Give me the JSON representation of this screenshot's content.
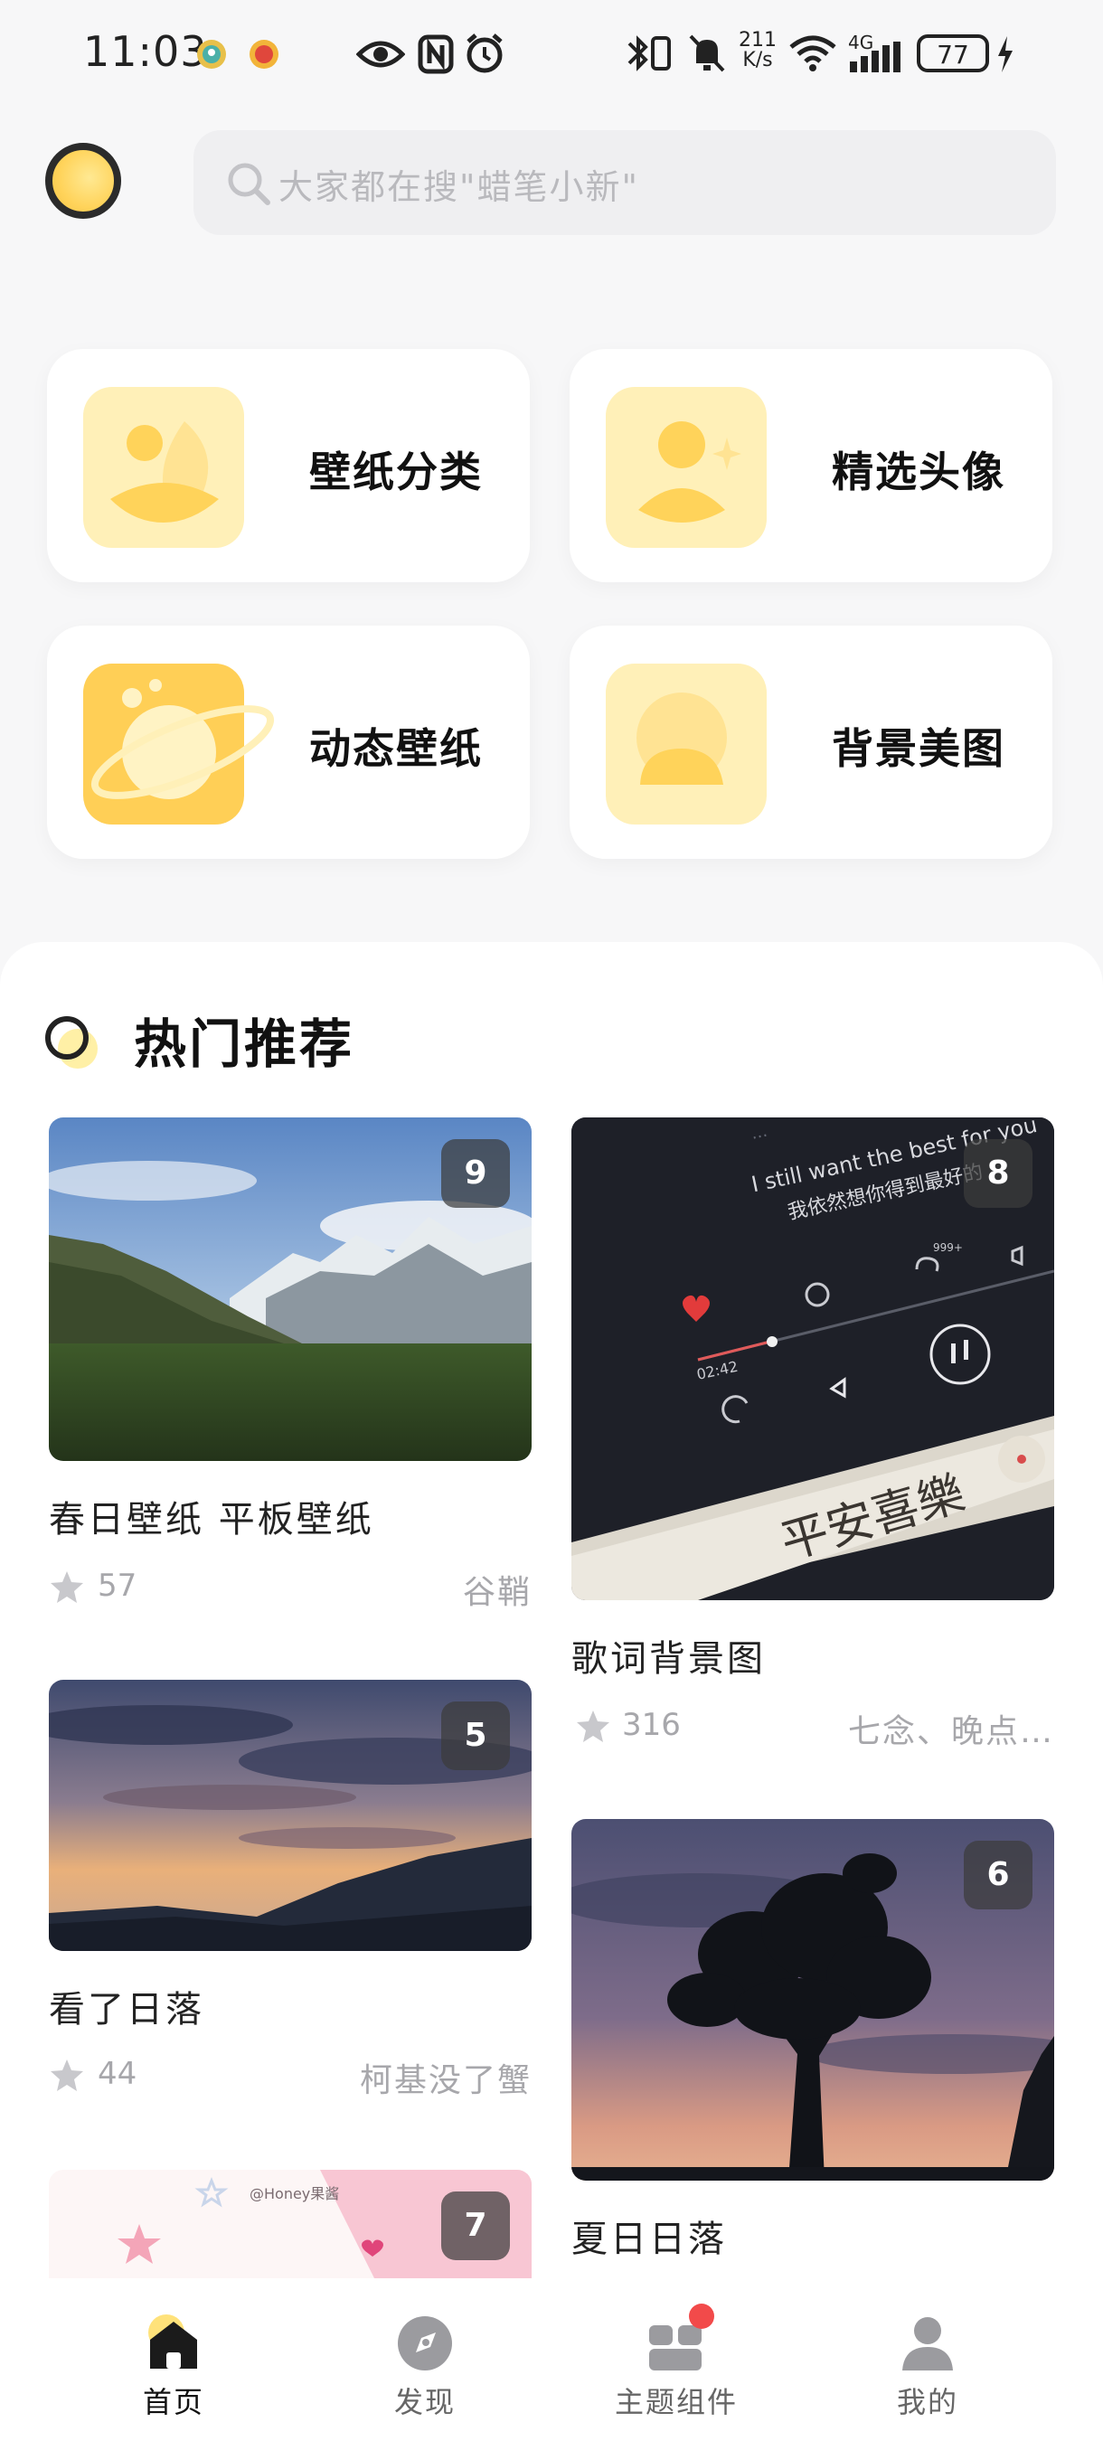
{
  "status_bar": {
    "time": "11:03",
    "net_speed_value": "211",
    "net_speed_unit": "K/s",
    "network": "4G",
    "battery": "77"
  },
  "search": {
    "placeholder": "大家都在搜\"蜡笔小新\""
  },
  "categories": [
    {
      "label": "壁纸分类",
      "icon": "landscape-icon"
    },
    {
      "label": "精选头像",
      "icon": "person-icon"
    },
    {
      "label": "动态壁纸",
      "icon": "planet-icon"
    },
    {
      "label": "背景美图",
      "icon": "bubble-icon"
    }
  ],
  "section": {
    "title": "热门推荐"
  },
  "cards": [
    {
      "title": "春日壁纸 平板壁纸",
      "count": "9",
      "likes": "57",
      "author": "谷鞘"
    },
    {
      "title": "歌词背景图",
      "count": "8",
      "likes": "316",
      "author": "七念、晚点…",
      "image_text": {
        "lyric_en": "I still want the best for you",
        "lyric_zh": "我依然想你得到最好的",
        "time": "02:42",
        "comment_count": "999+",
        "card_text": "平安喜樂"
      }
    },
    {
      "title": "看了日落",
      "count": "5",
      "likes": "44",
      "author": "柯基没了蟹"
    },
    {
      "title": "夏日日落",
      "count": "6"
    },
    {
      "count": "7",
      "image_text": {
        "watermark": "@Honey果酱"
      }
    }
  ],
  "bottom_nav": [
    {
      "label": "首页",
      "active": true
    },
    {
      "label": "发现",
      "active": false
    },
    {
      "label": "主题组件",
      "active": false
    },
    {
      "label": "我的",
      "active": false
    }
  ],
  "colors": {
    "accent_yellow": "#ffd35a",
    "badge_red": "#f24a4a",
    "text_gray": "#a7a7ab"
  }
}
